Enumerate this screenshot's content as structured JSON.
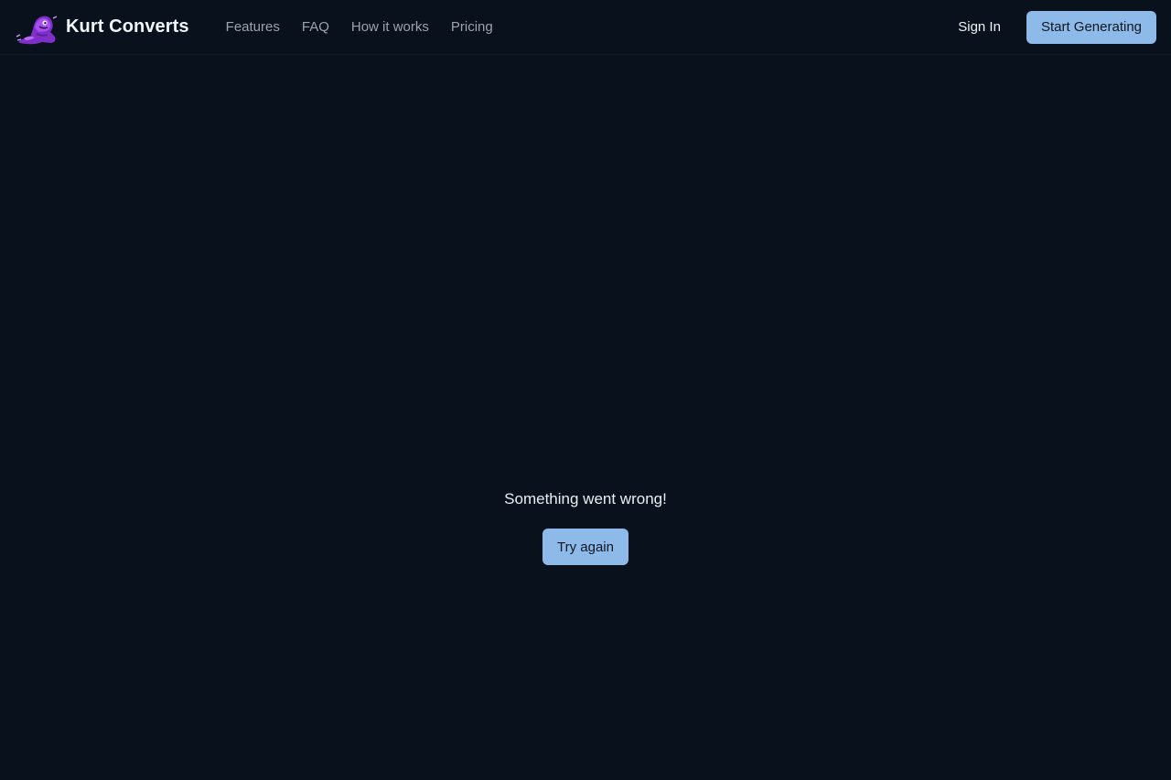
{
  "header": {
    "brand_name": "Kurt Converts",
    "logo_icon": "purple-mascot-logo-icon",
    "nav": [
      {
        "label": "Features"
      },
      {
        "label": "FAQ"
      },
      {
        "label": "How it works"
      },
      {
        "label": "Pricing"
      }
    ],
    "sign_in_label": "Sign In",
    "cta_label": "Start Generating"
  },
  "main": {
    "error_message": "Something went wrong!",
    "retry_label": "Try again"
  },
  "colors": {
    "background": "#09121c",
    "accent": "#8ebaea",
    "logo_purple": "#9b3fe0"
  }
}
